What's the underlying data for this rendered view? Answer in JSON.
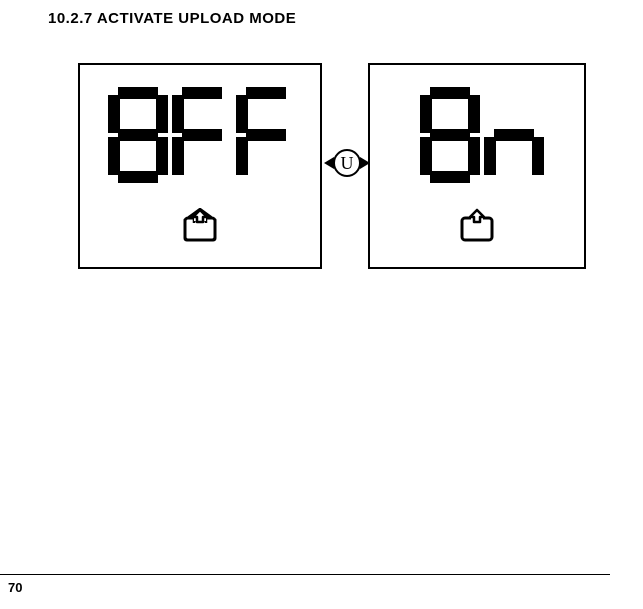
{
  "heading": "10.2.7  ACTIVATE UPLOAD MODE",
  "page_number": "70",
  "toggle_button_label": "U",
  "panels": {
    "left_value": "OFF",
    "right_value": "On"
  }
}
